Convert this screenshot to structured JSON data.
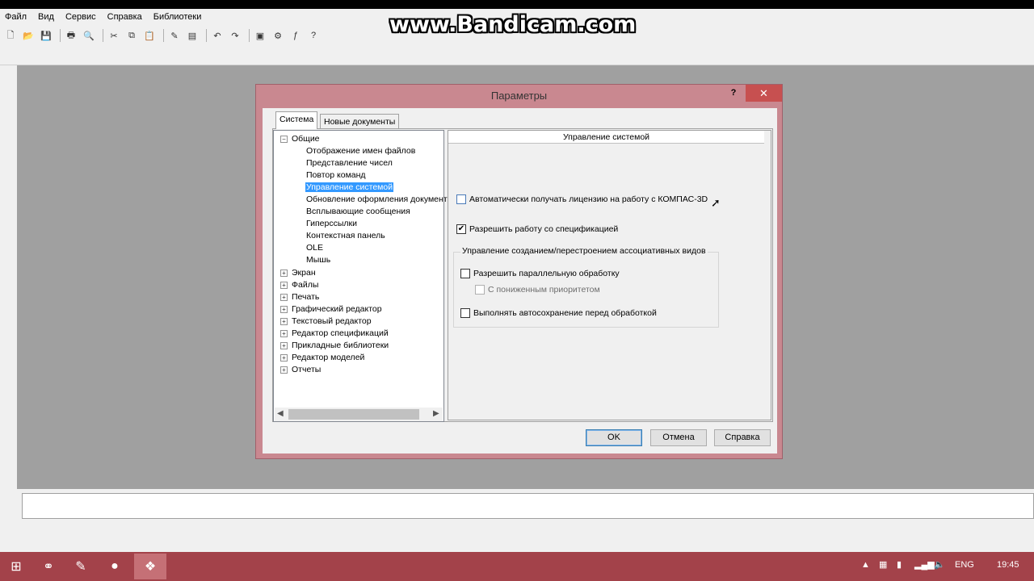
{
  "watermark": "www.Bandicam.com",
  "menu": [
    "Файл",
    "Вид",
    "Сервис",
    "Справка",
    "Библиотеки"
  ],
  "dialog": {
    "title": "Параметры",
    "help": "?",
    "close": "✕",
    "tabs": [
      "Система",
      "Новые документы"
    ],
    "tree": {
      "root": "Общие",
      "children": [
        "Отображение имен файлов",
        "Представление чисел",
        "Повтор команд",
        "Управление системой",
        "Обновление оформления документ",
        "Всплывающие сообщения",
        "Гиперссылки",
        "Контекстная панель",
        "OLE",
        "Мышь"
      ],
      "siblings": [
        "Экран",
        "Файлы",
        "Печать",
        "Графический редактор",
        "Текстовый редактор",
        "Редактор спецификаций",
        "Прикладные библиотеки",
        "Редактор моделей",
        "Отчеты"
      ],
      "selected": "Управление системой"
    },
    "panel": {
      "heading": "Управление системой",
      "license_label": "Автоматически получать лицензию на работу с КОМПАС-3D",
      "license_checked": false,
      "spec_label": "Разрешить работу со спецификацией",
      "spec_checked": true,
      "group_title": "Управление созданием/перестроением ассоциативных видов",
      "parallel_label": "Разрешить параллельную обработку",
      "parallel_checked": false,
      "lowprio_label": "С пониженным приоритетом",
      "lowprio_checked": false,
      "autosave_label": "Выполнять автосохранение перед обработкой",
      "autosave_checked": false
    },
    "buttons": {
      "ok": "OK",
      "cancel": "Отмена",
      "help": "Справка"
    }
  },
  "taskbar": {
    "lang": "ENG",
    "time": "19:45"
  }
}
